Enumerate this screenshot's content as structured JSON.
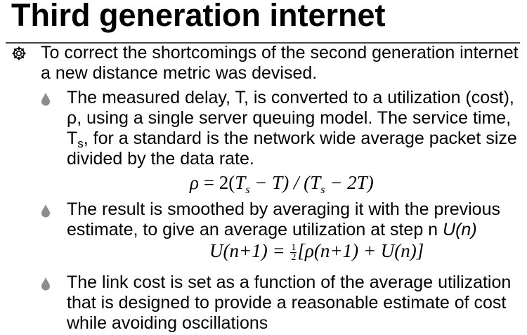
{
  "slide": {
    "title": "Third generation internet",
    "bullet1": {
      "icon": "gear-flower-bullet-icon",
      "text": "To correct the shortcomings of the second generation internet a new distance metric was devised."
    },
    "sub_bullets": [
      {
        "icon": "teardrop-bullet-icon",
        "part1": "The measured delay, T,  is converted to a utilization (cost), ρ, using a single server queuing model. The service time, T",
        "sub": "s",
        "part2": ",  for a standard  is the network wide average packet size divided by the data rate."
      },
      {
        "icon": "teardrop-bullet-icon",
        "text": "The result is smoothed by averaging it with the previous estimate, to give an average utilization at step n ",
        "emph": "U(n)"
      },
      {
        "icon": "teardrop-bullet-icon",
        "text": "The link cost is set as a function of the average utilization that is designed to provide a reasonable estimate of  cost while avoiding oscillations"
      }
    ],
    "formula1": {
      "rho": "ρ",
      "eq": " = 2(",
      "T": "T",
      "s": "s",
      "minus_T": " − T) / (",
      "T2": "T",
      "s2": "s",
      "tail": " − 2T)"
    },
    "formula2": {
      "lhs": "U(n+1) = ",
      "frac_num": "1",
      "frac_den": "2",
      "rhs": "[ρ(n+1) + U(n)]"
    }
  }
}
